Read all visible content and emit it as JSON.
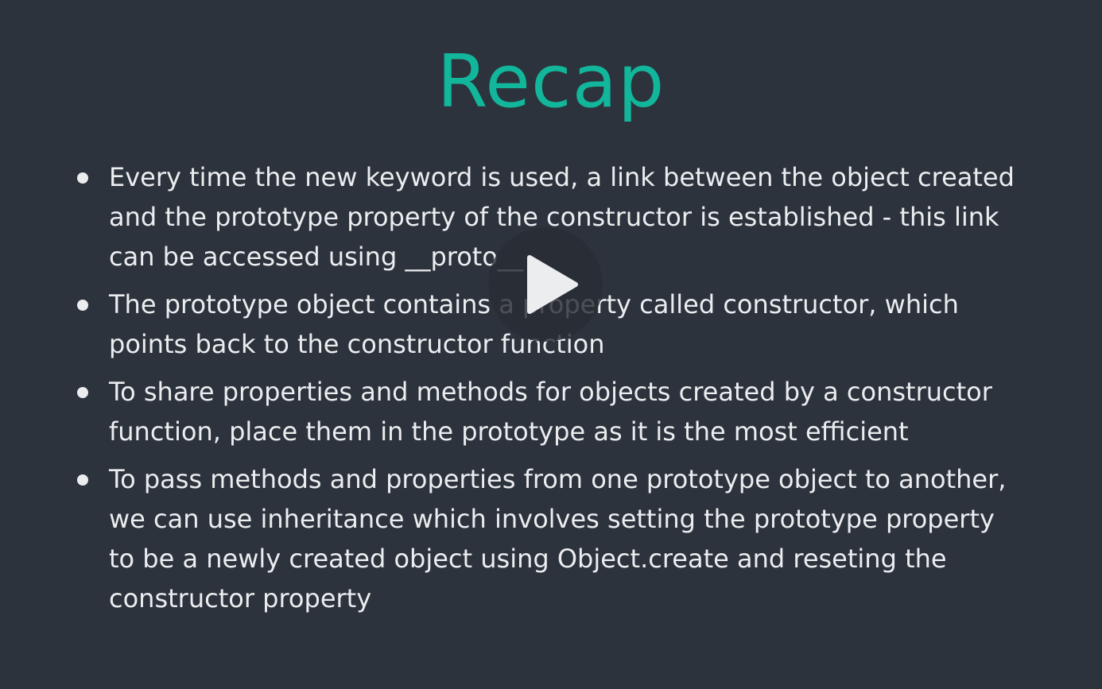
{
  "slide": {
    "title": "Recap",
    "bullets": [
      "Every time the new keyword is used, a link between the object created and the prototype property of the constructor is established - this link can be accessed using __proto__",
      "The prototype object contains a property called constructor, which points back to the constructor function",
      "To share properties and methods for objects created by a constructor function, place them in the prototype as it is the most efficient",
      "To pass methods and properties from one prototype object to another, we can use inheritance which involves setting the prototype property to be a newly created object using Object.create and reseting the constructor property"
    ]
  },
  "player": {
    "play_icon": "play-icon"
  },
  "colors": {
    "background": "#2d333d",
    "title": "#12b69a",
    "text": "#ebedef"
  }
}
